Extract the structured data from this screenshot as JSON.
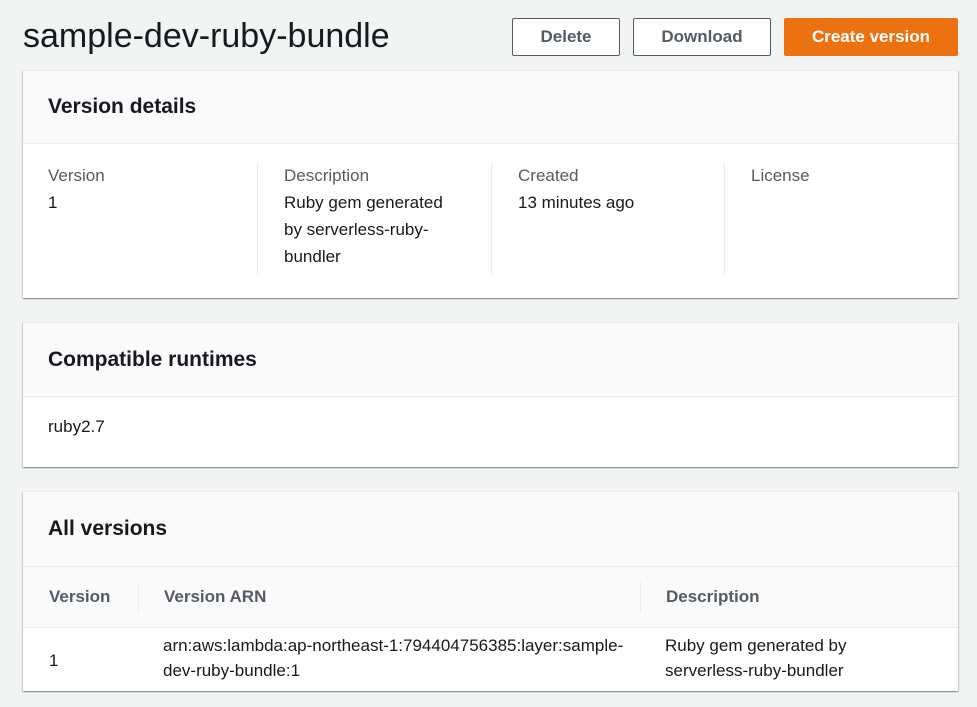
{
  "header": {
    "title": "sample-dev-ruby-bundle",
    "delete_label": "Delete",
    "download_label": "Download",
    "create_label": "Create version"
  },
  "colors": {
    "primary_button": "#ec7211",
    "page_background": "#f2f3f3"
  },
  "version_details": {
    "title": "Version details",
    "version": {
      "label": "Version",
      "value": "1"
    },
    "description": {
      "label": "Description",
      "value": "Ruby gem generated by serverless-ruby-bundler"
    },
    "created": {
      "label": "Created",
      "value": "13 minutes ago"
    },
    "license": {
      "label": "License",
      "value": ""
    }
  },
  "compatible_runtimes": {
    "title": "Compatible runtimes",
    "value": "ruby2.7"
  },
  "all_versions": {
    "title": "All versions",
    "columns": {
      "version": "Version",
      "arn": "Version ARN",
      "description": "Description"
    },
    "rows": [
      {
        "version": "1",
        "arn": "arn:aws:lambda:ap-northeast-1:794404756385:layer:sample-dev-ruby-bundle:1",
        "description": "Ruby gem generated by serverless-ruby-bundler"
      }
    ]
  }
}
